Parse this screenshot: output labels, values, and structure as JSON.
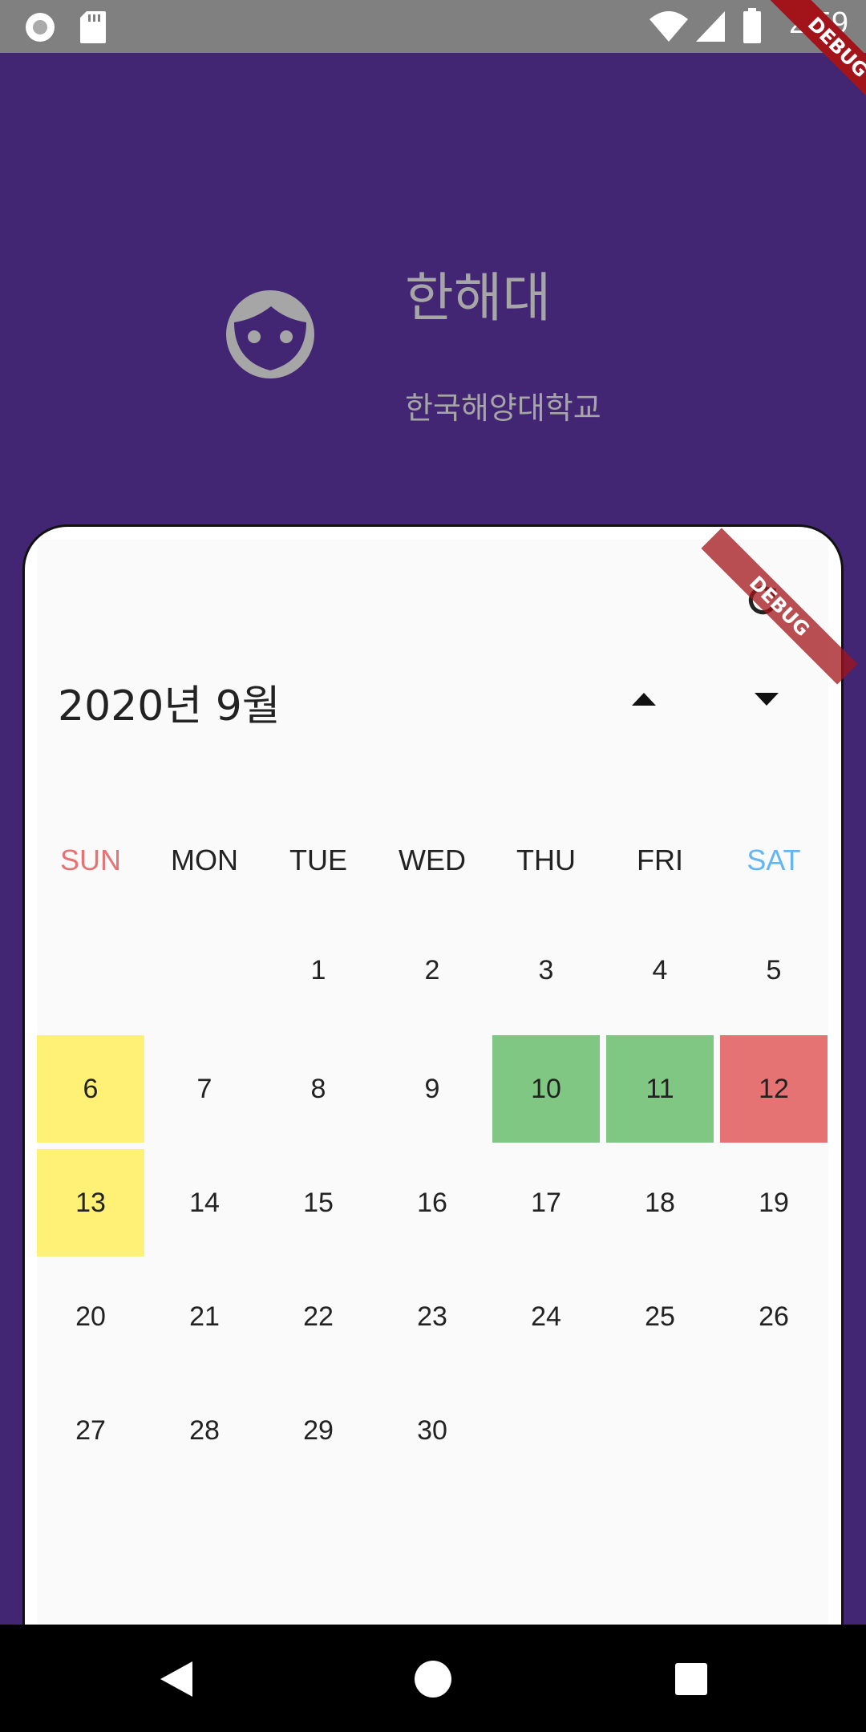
{
  "status_bar": {
    "time": "2:59"
  },
  "debug_label": "DEBUG",
  "profile": {
    "name": "한해대",
    "subtitle": "한국해양대학교"
  },
  "calendar": {
    "title": "2020년 9월",
    "weekdays": [
      "SUN",
      "MON",
      "TUE",
      "WED",
      "THU",
      "FRI",
      "SAT"
    ],
    "weekday_colors": {
      "SUN": "#e57373",
      "SAT": "#64b5f6"
    },
    "weeks": [
      [
        "",
        "",
        "1",
        "2",
        "3",
        "4",
        "5"
      ],
      [
        "6",
        "7",
        "8",
        "9",
        "10",
        "11",
        "12"
      ],
      [
        "13",
        "14",
        "15",
        "16",
        "17",
        "18",
        "19"
      ],
      [
        "20",
        "21",
        "22",
        "23",
        "24",
        "25",
        "26"
      ],
      [
        "27",
        "28",
        "29",
        "30",
        "",
        "",
        ""
      ]
    ],
    "highlights": {
      "6": "#fff176",
      "13": "#fff176",
      "10": "#81c784",
      "11": "#81c784",
      "12": "#e57373"
    }
  }
}
